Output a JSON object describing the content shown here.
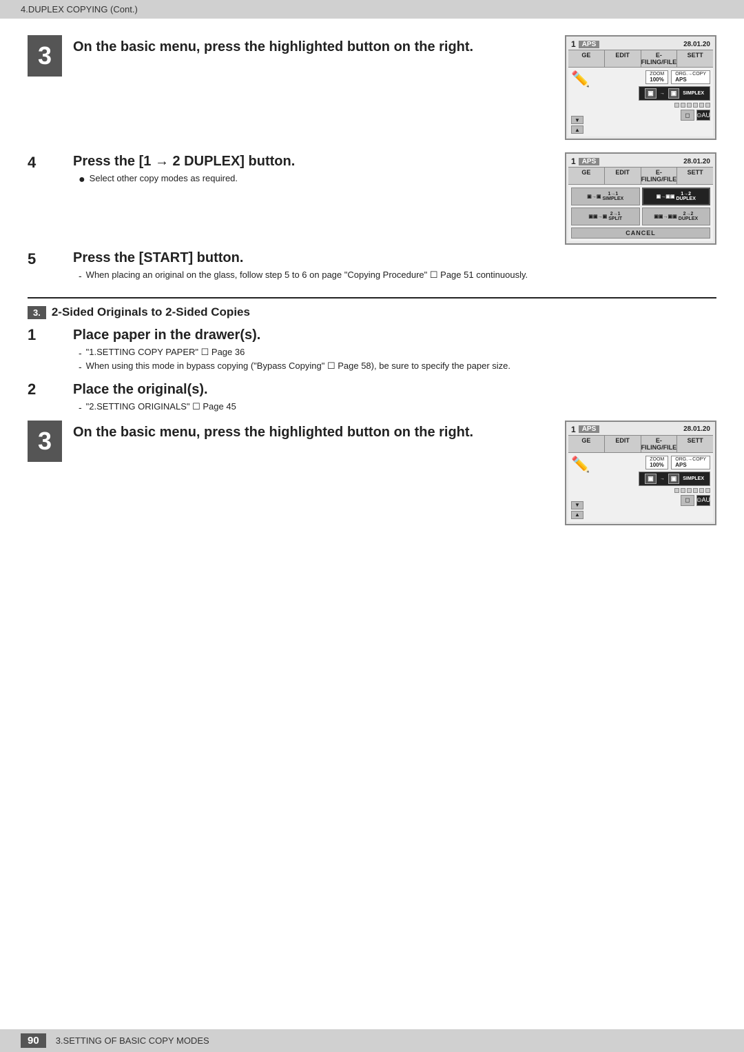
{
  "header": {
    "text": "4.DUPLEX COPYING (Cont.)"
  },
  "footer": {
    "page_number": "90",
    "text": "3.SETTING OF BASIC COPY MODES"
  },
  "section_title": "3. 2-Sided Originals to 2-Sided Copies",
  "steps": {
    "step3_title": "On the basic menu, press the highlighted button on the right.",
    "step4_title": "Press the [1 → 2 DUPLEX] button.",
    "step4_sub": "Select other copy modes as required.",
    "step5_title": "Press the [START] button.",
    "step5_sub": "When placing an original on the glass, follow step 5 to 6 on page \"Copying Procedure\" ☐ Page 51 continuously.",
    "section3_num": "3.",
    "section3_title": "2-Sided Originals to 2-Sided Copies",
    "sec3_step1_title": "Place paper in the drawer(s).",
    "sec3_step1_bullet1": "\"1.SETTING COPY PAPER\" ☐ Page 36",
    "sec3_step1_bullet2": "When using this mode in bypass copying (\"Bypass Copying\" ☐ Page 58), be sure to specify the paper size.",
    "sec3_step2_title": "Place the original(s).",
    "sec3_step2_bullet": "\"2.SETTING ORIGINALS\" ☐ Page 45",
    "sec3_step3_title": "On the basic menu, press the highlighted button on the right."
  },
  "screen1": {
    "num": "1",
    "aps": "APS",
    "date": "28.01.20",
    "tabs": [
      "GE",
      "EDIT",
      "E-FILING/FILE",
      "SETT"
    ],
    "zoom_label": "ZOOM",
    "zoom_val": "100%",
    "org_label": "ORG.→COPY",
    "org_val": "APS",
    "simplex_label": "SIMPLEX",
    "simplex_arrow": "1→1"
  },
  "screen2": {
    "num": "1",
    "aps": "APS",
    "date": "28.01.20",
    "tabs": [
      "GE",
      "EDIT",
      "E-FILING/FILE",
      "SETT"
    ],
    "btn_simplex": "SIMPLEX",
    "btn_simplex_arrow": "1→1",
    "btn_duplex12_arrow": "1→2",
    "btn_duplex12_label": "DUPLEX",
    "btn_duplex22_arrow": "2→2",
    "btn_duplex22_label": "DUPLEX",
    "btn_split_arrow": "2→1",
    "btn_split_label": "SPLIT",
    "cancel_label": "CANCEL"
  },
  "screen3": {
    "num": "1",
    "aps": "APS",
    "date": "28.01.20",
    "tabs": [
      "GE",
      "EDIT",
      "E-FILING/FILE",
      "SETT"
    ],
    "zoom_label": "ZOOM",
    "zoom_val": "100%",
    "org_label": "ORG.→COPY",
    "org_val": "APS",
    "simplex_label": "SIMPLEX",
    "simplex_arrow": "1→1"
  }
}
